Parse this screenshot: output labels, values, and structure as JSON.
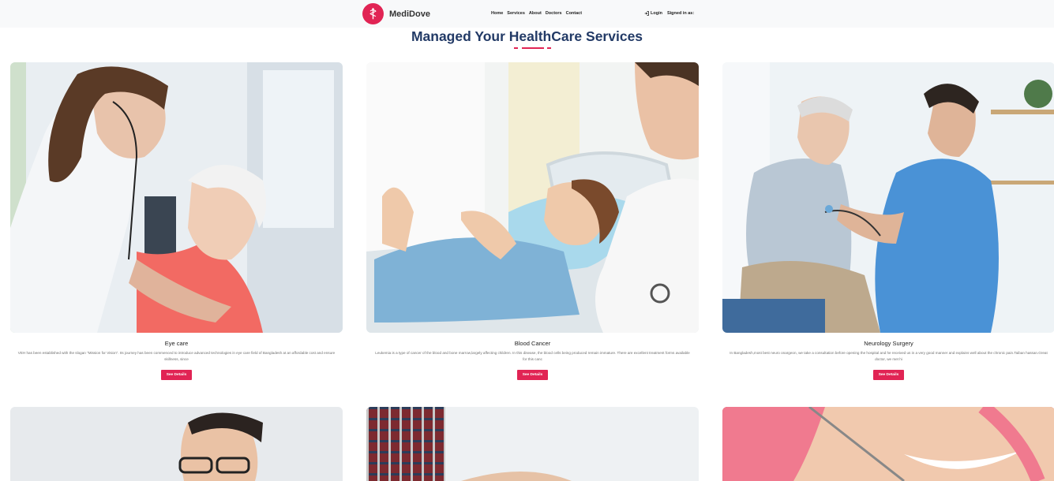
{
  "navbar": {
    "brand": "MediDove",
    "links": [
      "Home",
      "Services",
      "About",
      "Doctors",
      "Contact"
    ],
    "login": "Login",
    "signed_in": "Signed in as:"
  },
  "page": {
    "title": "Managed Your HealthCare Services"
  },
  "services": [
    {
      "title": "Eye care",
      "description": "VEH has been established with the slogan \"Mission for Vision\". Its journey has been commenced to introduce advanced technologies in eye care field of Bangladesh at an affordable cost and ensure skillness, since",
      "button": "See Details"
    },
    {
      "title": "Blood Cancer",
      "description": "Leukemia is a type of cancer of the blood and bone marrow,largely affecting children. In this disease, the blood cells being produced remain immature. There are excellent treatment forms available for this canc",
      "button": "See Details"
    },
    {
      "title": "Neurology Surgery",
      "description": "In Bangladesh,most best neuro onargeon, we take a consultation before opening the hospital and he received us in a very good manner and explains well about the chronic pain.Taiban hassan.Great doctor, we met hi",
      "button": "See Details"
    }
  ],
  "colors": {
    "accent": "#e12454",
    "heading": "#223a66",
    "navbar_bg": "#f8f9fa"
  }
}
